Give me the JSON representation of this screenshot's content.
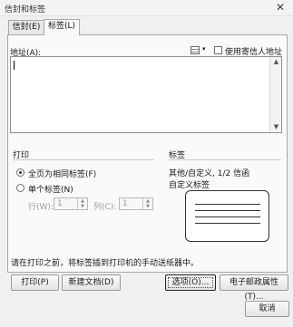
{
  "window": {
    "title": "信封和标签",
    "close_glyph": "✕"
  },
  "tabs": [
    {
      "label": "信封(E)"
    },
    {
      "label": "标签(L)"
    }
  ],
  "address": {
    "label": "地址(A):",
    "value": "",
    "use_return_label": "使用寄信人地址(R)",
    "book_icon": "address-book-icon"
  },
  "print": {
    "group_label": "打印",
    "full_page_label": "全页为相同标签(F)",
    "single_label": "单个标签(N)",
    "row_label": "行(W):",
    "row_value": "1",
    "col_label": "列(C):",
    "col_value": "1"
  },
  "label_info": {
    "group_label": "标签",
    "line1": "其他/自定义, 1/2 信函",
    "line2": "自定义标签"
  },
  "hint": "请在打印之前，将标签插到打印机的手动送纸器中。",
  "buttons": {
    "print": "打印(P)",
    "new_document": "新建文档(D)",
    "options": "选项(O)...",
    "e_postage": "电子邮政属性(T)...",
    "cancel": "取消"
  },
  "colors": {
    "dialog_bg": "#f0f0f0",
    "panel_bg": "#fafafa"
  }
}
